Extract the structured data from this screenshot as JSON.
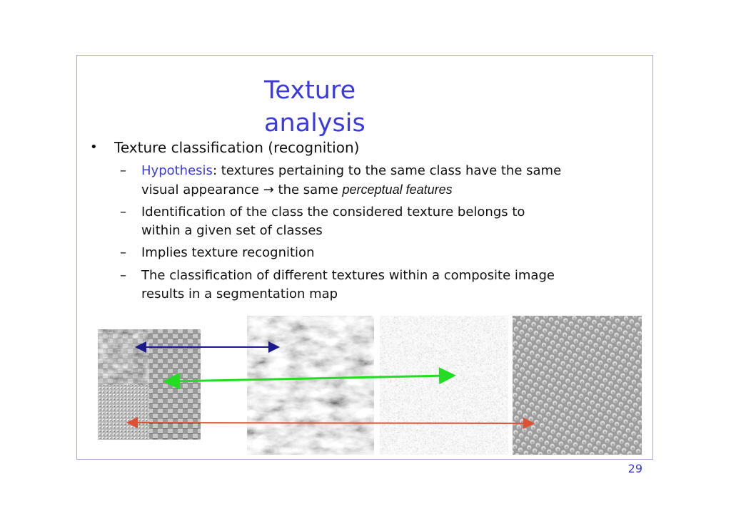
{
  "slide": {
    "title": "Texture analysis",
    "bullet": "Texture classification (recognition)",
    "sub_items": [
      {
        "prefix": "Hypothesis",
        "text_line1": ": textures pertaining to the same class have the same",
        "text_line2": "visual  appearance → the same ",
        "italic": "perceptual features"
      },
      {
        "text_line1": "Identification of the class the considered texture belongs to",
        "text_line2": "within a  given set of classes"
      },
      {
        "text_line1": "Implies texture recognition"
      },
      {
        "text_line1": "The classification of different textures within a composite image",
        "text_line2": "results  in a segmentation map"
      }
    ],
    "page_number": "29"
  },
  "colors": {
    "title": "#3a3ae0",
    "arrow_blue": "#1a1a8c",
    "arrow_green": "#22dd22",
    "arrow_red": "#e05030"
  }
}
